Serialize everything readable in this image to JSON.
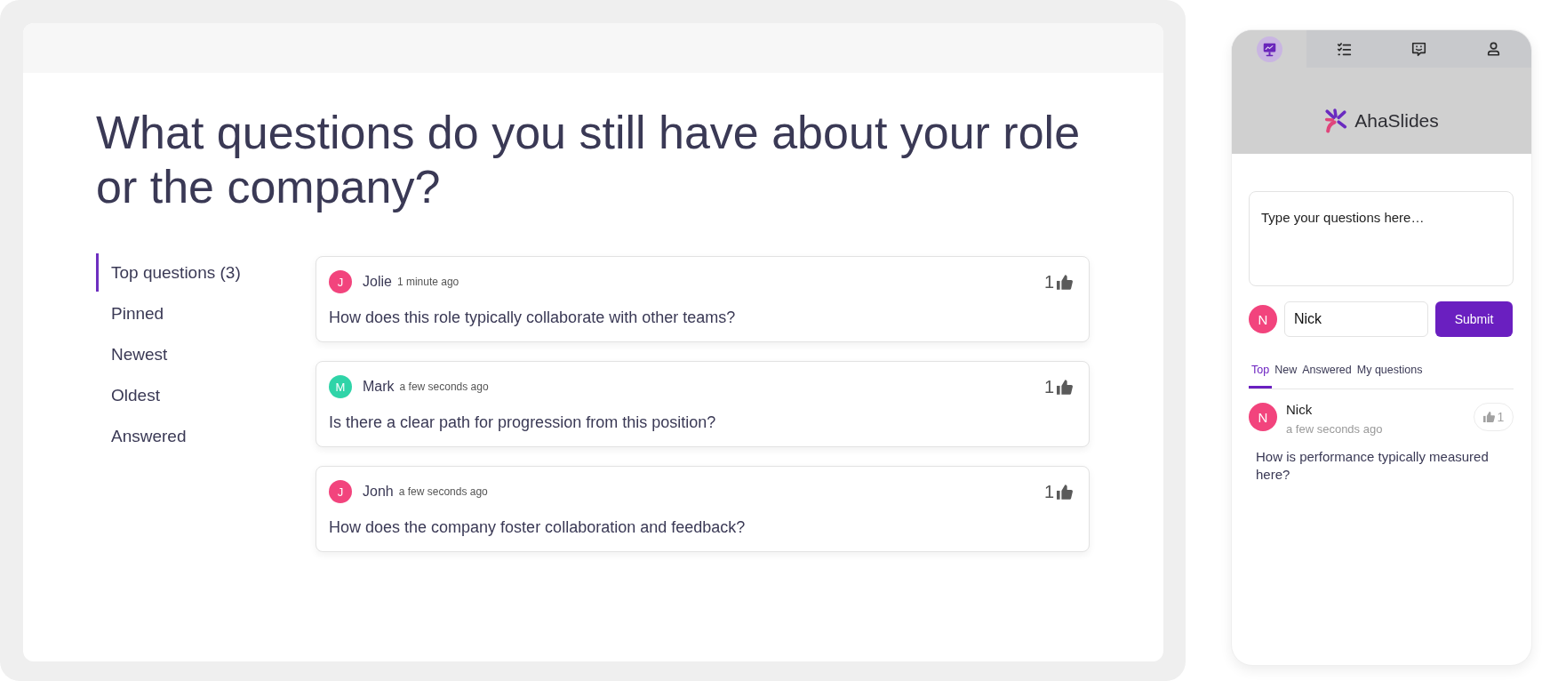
{
  "presentation": {
    "title": "What questions do you still have about your role or the company?",
    "filters": [
      {
        "label": "Top questions (3)",
        "selected": true
      },
      {
        "label": "Pinned",
        "selected": false
      },
      {
        "label": "Newest",
        "selected": false
      },
      {
        "label": "Oldest",
        "selected": false
      },
      {
        "label": "Answered",
        "selected": false
      }
    ],
    "questions": [
      {
        "initial": "J",
        "color": "#f2447d",
        "author": "Jolie",
        "time": "1 minute ago",
        "likes": "1",
        "text": "How does this role typically collaborate with other teams?"
      },
      {
        "initial": "M",
        "color": "#2fd4a8",
        "author": "Mark",
        "time": "a few seconds ago",
        "likes": "1",
        "text": "Is there a clear path for progression from this position?"
      },
      {
        "initial": "J",
        "color": "#f2447d",
        "author": "Jonh",
        "time": "a few seconds ago",
        "likes": "1",
        "text": "How does the company foster collaboration and feedback?"
      }
    ]
  },
  "audience_phone": {
    "nav_tabs": [
      {
        "kind": "slides",
        "selected": true
      },
      {
        "kind": "list",
        "selected": false
      },
      {
        "kind": "chat",
        "selected": false
      },
      {
        "kind": "profile",
        "selected": false
      }
    ],
    "brand": "AhaSlides",
    "question_field": {
      "placeholder": "Type your questions here…"
    },
    "user": {
      "initial": "N",
      "color": "#f2447d"
    },
    "name_field": {
      "value": "Nick"
    },
    "submit_button": "Submit",
    "tabs": [
      {
        "label": "Top",
        "selected": true
      },
      {
        "label": "New",
        "selected": false
      },
      {
        "label": "Answered",
        "selected": false
      },
      {
        "label": "My questions",
        "selected": false
      }
    ],
    "questions": [
      {
        "initial": "N",
        "color": "#f2447d",
        "author": "Nick",
        "time": "a few seconds ago",
        "likes": "1",
        "text": "How is performance typically measured here?"
      }
    ]
  }
}
